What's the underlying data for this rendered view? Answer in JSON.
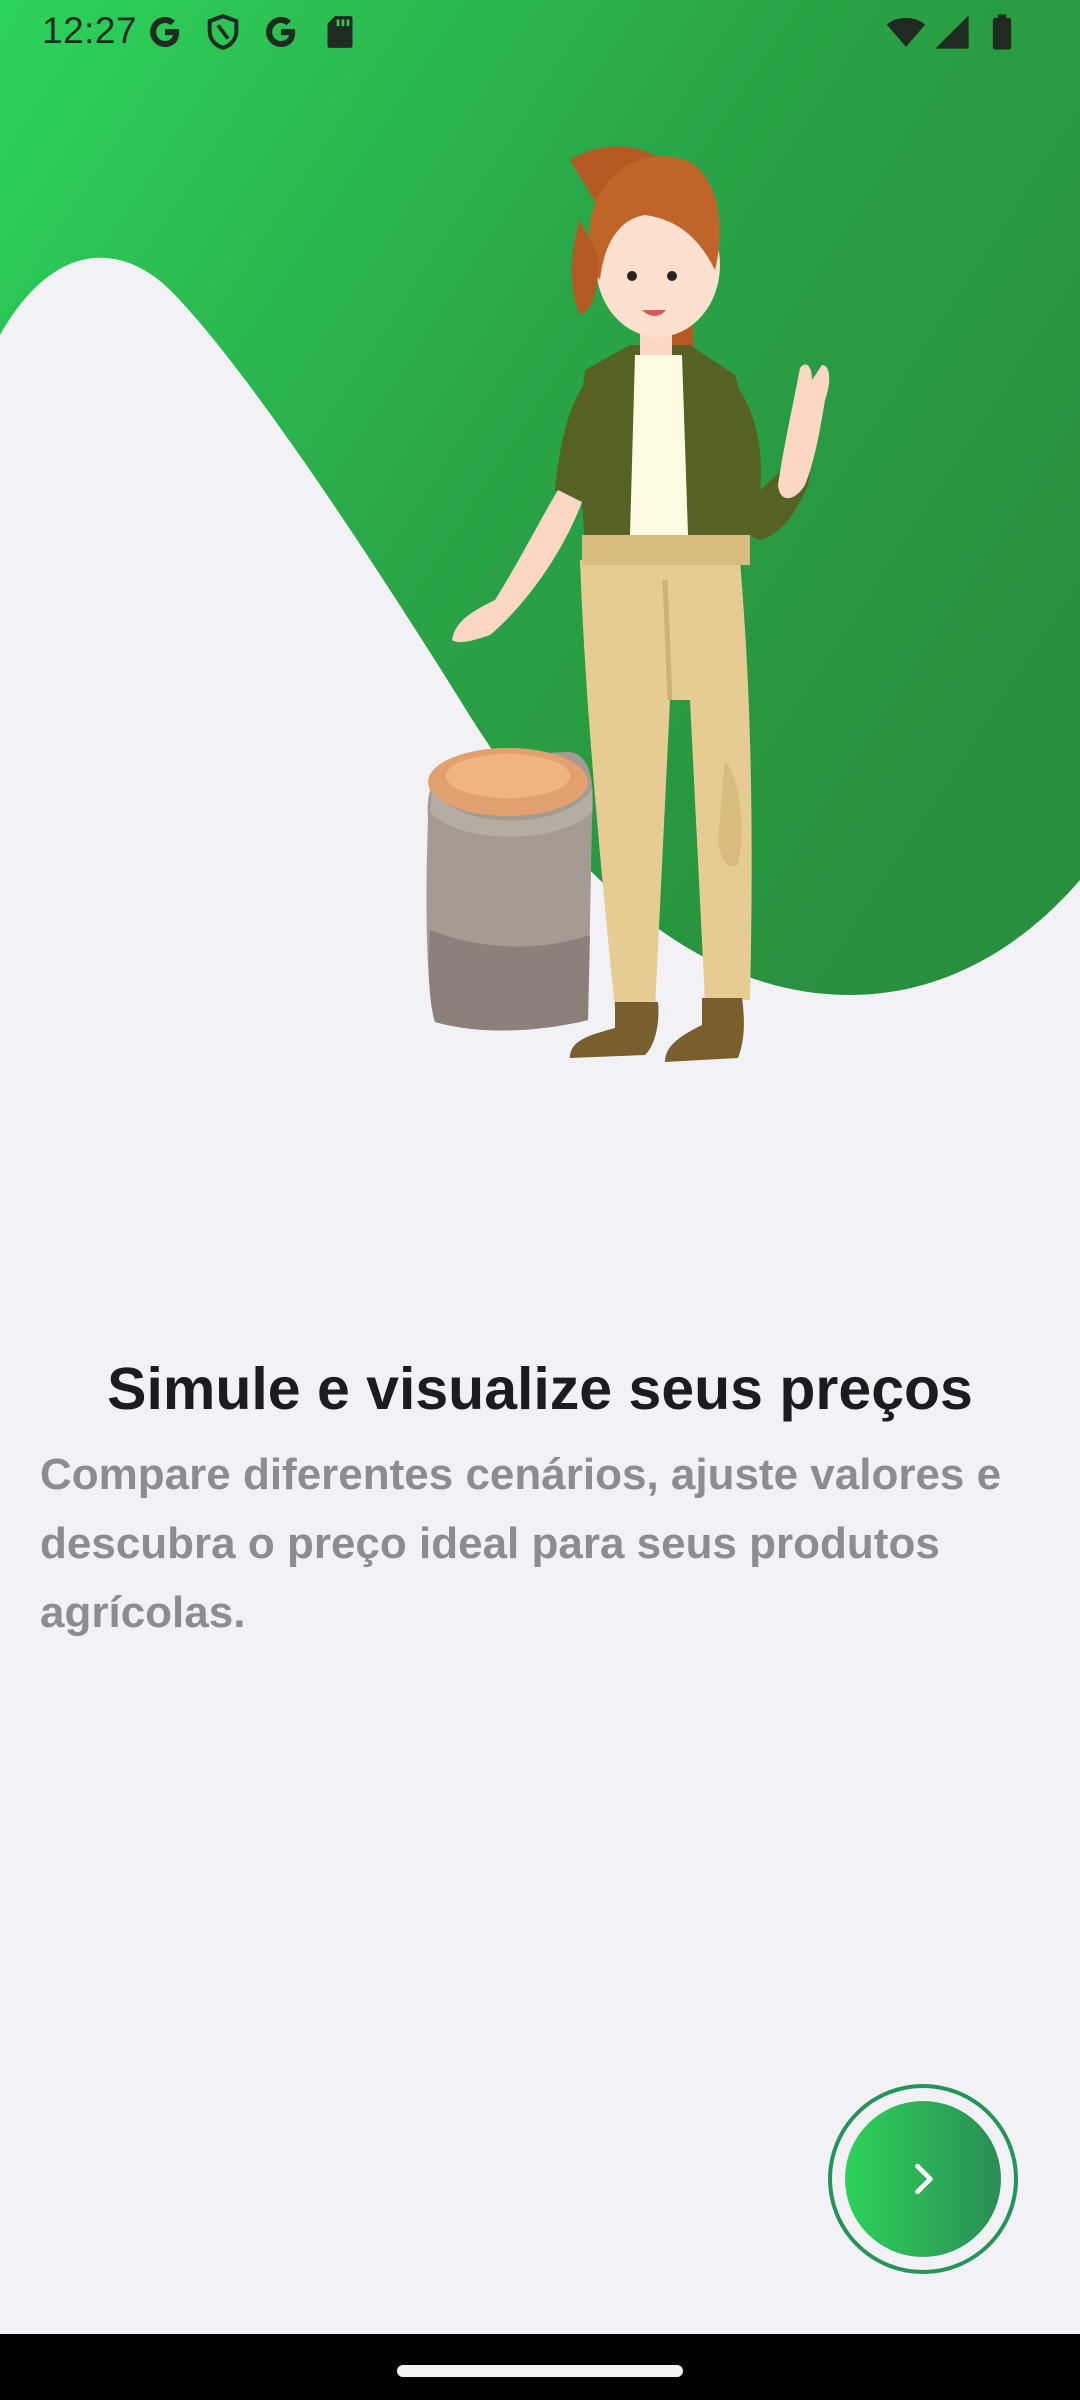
{
  "status_bar": {
    "time": "12:27",
    "left_icons": [
      "google-g-icon",
      "shield-icon",
      "google-g-icon",
      "sd-card-icon"
    ],
    "right_icons": [
      "wifi-icon",
      "signal-icon",
      "battery-icon"
    ]
  },
  "onboarding": {
    "title": "Simule e visualize seus preços",
    "description": "Compare diferentes cenários, ajuste valores e descubra o preço ideal para seus produtos agrícolas.",
    "illustration": "farmer-woman-with-grain-sack-illustration",
    "next_button_icon": "chevron-right-icon"
  },
  "colors": {
    "background": "#f2f1f6",
    "wave_light": "#2dd35b",
    "wave_dark": "#288f3e",
    "title_text": "#1c1c1f",
    "description_text": "#8d8c92",
    "button_ring": "#26945a"
  }
}
